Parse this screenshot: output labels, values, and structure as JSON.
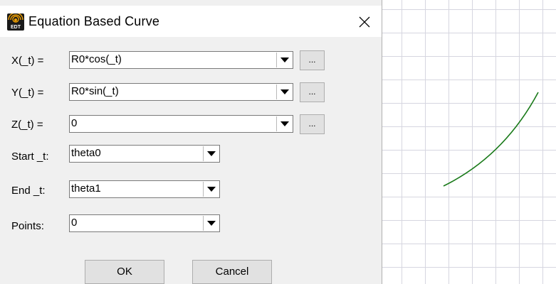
{
  "dialog": {
    "title": "Equation Based Curve",
    "icon_text": "EDT",
    "icon": "ansys-edt-icon",
    "close_icon": "close-icon"
  },
  "fields": {
    "x": {
      "label": "X(_t) =",
      "value": "R0*cos(_t)",
      "browse": "..."
    },
    "y": {
      "label": "Y(_t) =",
      "value": "R0*sin(_t)",
      "browse": "..."
    },
    "z": {
      "label": "Z(_t) =",
      "value": "0",
      "browse": "..."
    },
    "start": {
      "label": "Start _t:",
      "value": "theta0"
    },
    "end": {
      "label": "End _t:",
      "value": "theta1"
    },
    "points": {
      "label": "Points:",
      "value": "0"
    }
  },
  "buttons": {
    "ok": "OK",
    "cancel": "Cancel"
  },
  "colors": {
    "curve": "#1a7a1a",
    "axis": "#d00000",
    "grid": "#d6d6e0",
    "dialog_bg": "#f0f0f0"
  }
}
